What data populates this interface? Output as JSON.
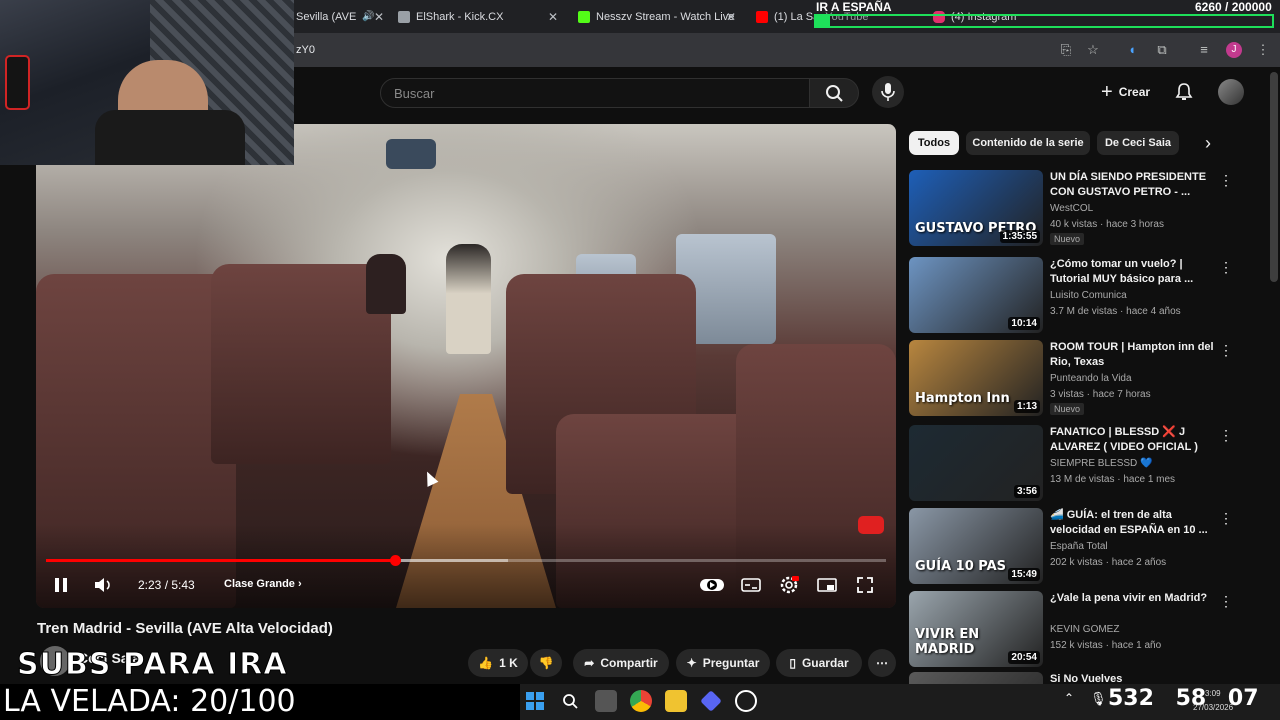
{
  "browser": {
    "tabs": [
      {
        "label": "Sevilla (AVE",
        "color": "#ff0000"
      },
      {
        "label": "ElShark - Kick.CX",
        "color": "#9aa0a6"
      },
      {
        "label": "Nesszv Stream - Watch Live",
        "color": "#53fc18"
      },
      {
        "label": "(1) La Sa",
        "color": "#ff0000"
      },
      {
        "label": "YouTube",
        "color": "#ff0000"
      },
      {
        "label": "(4) Instagram",
        "color": "#e1306c"
      }
    ],
    "url_fragment": "zY0"
  },
  "youtube": {
    "search_placeholder": "Buscar",
    "create_label": "Crear",
    "video": {
      "time": "2:23 / 5:43",
      "chapter": "Clase Grande",
      "progress_fraction": 0.416,
      "buffered_fraction": 0.55,
      "title": "Tren Madrid - Sevilla (AVE Alta Velocidad)",
      "channel": "Ceci Saia"
    },
    "actions": {
      "likes": "1 K",
      "share": "Compartir",
      "ask": "Preguntar",
      "save": "Guardar"
    },
    "chips": [
      "Todos",
      "Contenido de la serie",
      "De Ceci Saia"
    ],
    "recommendations": [
      {
        "title": "UN DÍA SIENDO PRESIDENTE CON GUSTAVO PETRO - ...",
        "channel": "WestCOL",
        "meta": "40 k vistas · hace 3 horas",
        "badge": "Nuevo",
        "duration": "1:35:55",
        "thumb_text": "GUSTAVO PETRO",
        "thumb_color": "#1e5fb8"
      },
      {
        "title": "¿Cómo tomar un vuelo? | Tutorial MUY básico para ...",
        "channel": "Luisito Comunica",
        "meta": "3.7 M de vistas · hace 4 años",
        "badge": "",
        "duration": "10:14",
        "thumb_text": "",
        "thumb_color": "#6d94c2"
      },
      {
        "title": "ROOM TOUR | Hampton inn del Rio, Texas",
        "channel": "Punteando la Vida",
        "meta": "3 vistas · hace 7 horas",
        "badge": "Nuevo",
        "duration": "1:13",
        "thumb_text": "Hampton Inn",
        "thumb_color": "#b8863f"
      },
      {
        "title": "FANATICO | BLESSD ❌ J ALVAREZ ( VIDEO OFICIAL )",
        "channel": "SIEMPRE BLESSD 💙",
        "meta": "13 M de vistas · hace 1 mes",
        "badge": "",
        "duration": "3:56",
        "thumb_text": "",
        "thumb_color": "#1d2a33"
      },
      {
        "title": "🚄 GUÍA: el tren de alta velocidad en ESPAÑA en 10 ...",
        "channel": "España Total",
        "meta": "202 k vistas · hace 2 años",
        "badge": "",
        "duration": "15:49",
        "thumb_text": "GUÍA 10 PAS",
        "thumb_color": "#8a97a6"
      },
      {
        "title": "¿Vale la pena vivir en Madrid?",
        "channel": "KEVIN GOMEZ",
        "meta": "152 k vistas · hace 1 año",
        "badge": "",
        "duration": "20:54",
        "thumb_text": "VIVIR EN MADRID",
        "thumb_color": "#9aa5ad"
      },
      {
        "title": "Si No Vuelves",
        "channel": "",
        "meta": "",
        "badge": "",
        "duration": "",
        "thumb_text": "",
        "thumb_color": "#5a5a5a"
      }
    ]
  },
  "overlay": {
    "banner": "IR A ESPAÑA",
    "goal_text": "6260 / 200000",
    "goal_fraction": 0.0313,
    "subs_text": "SUBS PARA IRA",
    "velada_text": "LA VELADA: 20/100",
    "counter": "532",
    "counter2": "58",
    "counter3": "07"
  },
  "taskbar": {
    "clock": "3:09",
    "date": "27/03/2026"
  }
}
